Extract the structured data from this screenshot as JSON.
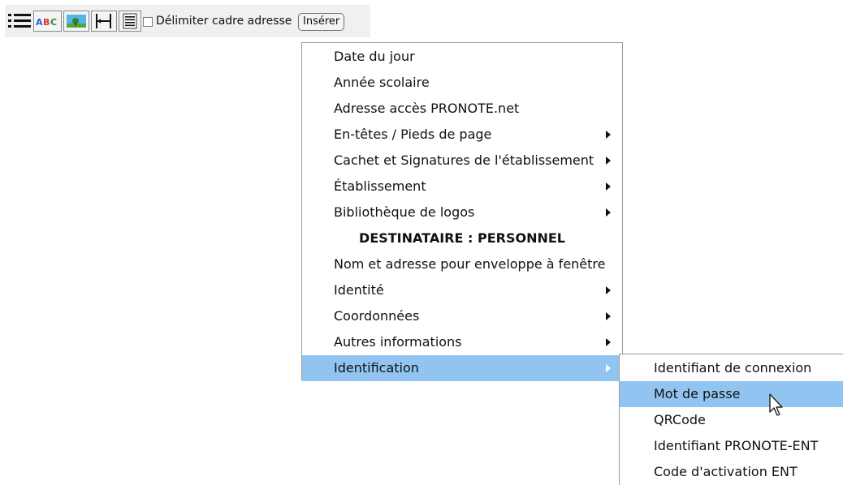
{
  "toolbar": {
    "icons": [
      "list-icon",
      "abc-spellcheck-icon",
      "image-icon",
      "column-icon",
      "text-block-icon"
    ],
    "checkbox_label": "Délimiter cadre adresse",
    "checkbox_checked": false,
    "insert_button": "Insérer"
  },
  "menu": {
    "items": [
      {
        "label": "Date du jour",
        "submenu": false
      },
      {
        "label": "Année scolaire",
        "submenu": false
      },
      {
        "label": "Adresse accès PRONOTE.net",
        "submenu": false
      },
      {
        "label": "En-têtes / Pieds de page",
        "submenu": true
      },
      {
        "label": "Cachet et Signatures de l'établissement",
        "submenu": true
      },
      {
        "label": "Établissement",
        "submenu": true
      },
      {
        "label": "Bibliothèque de logos",
        "submenu": true
      },
      {
        "label": "DESTINATAIRE : PERSONNEL",
        "section": true
      },
      {
        "label": "Nom et adresse pour enveloppe à fenêtre",
        "submenu": false
      },
      {
        "label": "Identité",
        "submenu": true
      },
      {
        "label": "Coordonnées",
        "submenu": true
      },
      {
        "label": "Autres informations",
        "submenu": true
      },
      {
        "label": "Identification",
        "submenu": true,
        "highlighted": true
      }
    ]
  },
  "submenu": {
    "items": [
      {
        "label": "Identifiant de connexion"
      },
      {
        "label": "Mot de passe",
        "highlighted": true
      },
      {
        "label": "QRCode"
      },
      {
        "label": "Identifiant PRONOTE-ENT"
      },
      {
        "label": "Code d'activation ENT"
      }
    ]
  },
  "colors": {
    "highlight": "#92c4f2",
    "menu_border": "#9c9c9c",
    "toolbar_bg": "#f0f0f0"
  }
}
